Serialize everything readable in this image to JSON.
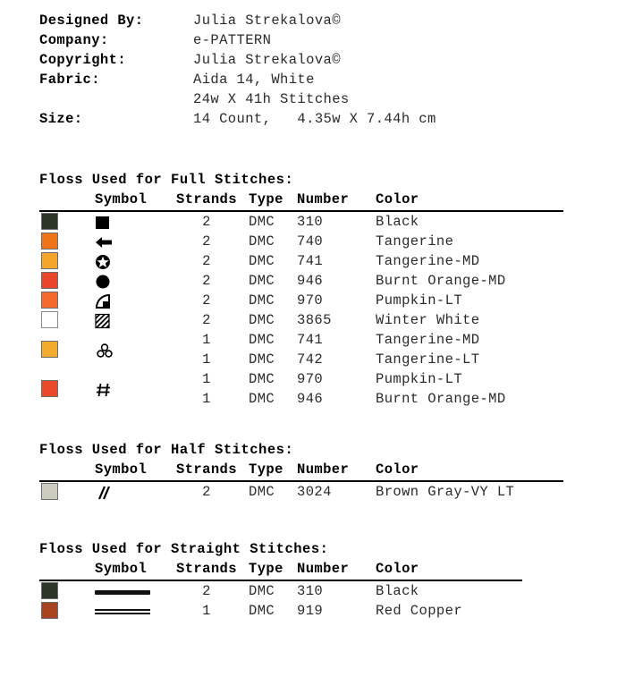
{
  "header": {
    "rows": [
      {
        "label": "Designed By:",
        "value": "Julia Strekalova©"
      },
      {
        "label": "Company:",
        "value": "e-PATTERN"
      },
      {
        "label": "Copyright:",
        "value": "Julia Strekalova©"
      },
      {
        "label": "Fabric:",
        "value": "Aida 14, White"
      },
      {
        "label": "",
        "value": "24w X 41h Stitches"
      },
      {
        "label": "Size:",
        "value": "14 Count,   4.35w X 7.44h cm"
      }
    ]
  },
  "columns": {
    "symbol": "Symbol",
    "strands": "Strands",
    "type": "Type",
    "number": "Number",
    "color": "Color"
  },
  "full_stitches": {
    "title": "Floss Used for Full Stitches:",
    "rows": [
      {
        "swatch": "#2d3529",
        "symbol": "filled-square-icon",
        "strands": "2",
        "type": "DMC",
        "number": "310",
        "color": "Black"
      },
      {
        "swatch": "#ef7318",
        "symbol": "left-arrow-icon",
        "strands": "2",
        "type": "DMC",
        "number": "740",
        "color": "Tangerine"
      },
      {
        "swatch": "#f5a52c",
        "symbol": "star-in-circle-icon",
        "strands": "2",
        "type": "DMC",
        "number": "741",
        "color": "Tangerine-MD"
      },
      {
        "swatch": "#e8452b",
        "symbol": "filled-circle-icon",
        "strands": "2",
        "type": "DMC",
        "number": "946",
        "color": "Burnt Orange-MD"
      },
      {
        "swatch": "#f4692e",
        "symbol": "quarter-pie-icon",
        "strands": "2",
        "type": "DMC",
        "number": "970",
        "color": "Pumpkin-LT"
      },
      {
        "swatch": "#ffffff",
        "symbol": "hatched-square-icon",
        "strands": "2",
        "type": "DMC",
        "number": "3865",
        "color": "Winter White"
      },
      {
        "swatch": "#f2ab2e",
        "swatch_span": 2,
        "symbol": "cloverleaf-icon",
        "symbol_span": 2,
        "strands": "1",
        "type": "DMC",
        "number": "741",
        "color": "Tangerine-MD"
      },
      {
        "swatch": null,
        "symbol": null,
        "strands": "1",
        "type": "DMC",
        "number": "742",
        "color": "Tangerine-LT"
      },
      {
        "swatch": "#ea4a2a",
        "swatch_span": 2,
        "symbol": "hash-icon",
        "symbol_span": 2,
        "strands": "1",
        "type": "DMC",
        "number": "970",
        "color": "Pumpkin-LT"
      },
      {
        "swatch": null,
        "symbol": null,
        "strands": "1",
        "type": "DMC",
        "number": "946",
        "color": "Burnt Orange-MD"
      }
    ]
  },
  "half_stitches": {
    "title": "Floss Used for Half Stitches:",
    "rows": [
      {
        "swatch": "#ccccc0",
        "symbol": "double-slash-icon",
        "strands": "2",
        "type": "DMC",
        "number": "3024",
        "color": "Brown Gray-VY LT"
      }
    ]
  },
  "straight_stitches": {
    "title": "Floss Used for Straight Stitches:",
    "rows": [
      {
        "swatch": "#2d3529",
        "symbol": "thick-line-icon",
        "strands": "2",
        "type": "DMC",
        "number": "310",
        "color": "Black"
      },
      {
        "swatch": "#a8431f",
        "symbol": "thin-line-icon",
        "strands": "1",
        "type": "DMC",
        "number": "919",
        "color": "Red Copper"
      }
    ]
  }
}
